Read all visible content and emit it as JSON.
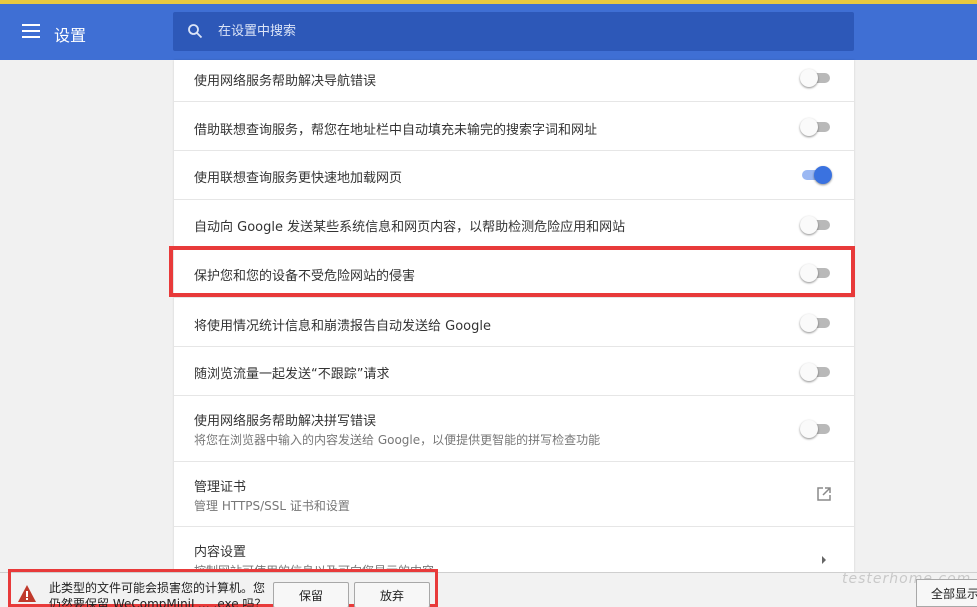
{
  "header": {
    "title": "设置",
    "search_placeholder": "在设置中搜索"
  },
  "settings": [
    {
      "label": "使用网络服务帮助解决导航错误",
      "toggle": "off"
    },
    {
      "label": "借助联想查询服务，帮您在地址栏中自动填充未输完的搜索字词和网址",
      "toggle": "off"
    },
    {
      "label": "使用联想查询服务更快速地加载网页",
      "toggle": "on"
    },
    {
      "label": "自动向 Google 发送某些系统信息和网页内容，以帮助检测危险应用和网站",
      "toggle": "off"
    },
    {
      "label": "保护您和您的设备不受危险网站的侵害",
      "toggle": "off"
    },
    {
      "label": "将使用情况统计信息和崩溃报告自动发送给 Google",
      "toggle": "off"
    },
    {
      "label": "随浏览流量一起发送“不跟踪”请求",
      "toggle": "off"
    },
    {
      "label": "使用网络服务帮助解决拼写错误",
      "sublabel": "将您在浏览器中输入的内容发送给 Google，以便提供更智能的拼写检查功能",
      "toggle": "off"
    },
    {
      "label": "管理证书",
      "sublabel": "管理 HTTPS/SSL 证书和设置",
      "icon": "external-link-icon"
    },
    {
      "label": "内容设置",
      "sublabel": "控制网站可使用的信息以及可向您显示的内容",
      "icon": "chevron-right-icon"
    }
  ],
  "download_bar": {
    "warning_text": "此类型的文件可能会损害您的计算机。您仍然要保留 WeCompMiniL… .exe 吗？",
    "keep_label": "保留",
    "discard_label": "放弃",
    "show_all_label": "全部显示"
  },
  "watermark": "testerhome.com",
  "colors": {
    "header": "#3f6fd4",
    "search": "#2d58b8",
    "toggle_on": "#3a72e0",
    "highlight": "#e83a3a"
  }
}
